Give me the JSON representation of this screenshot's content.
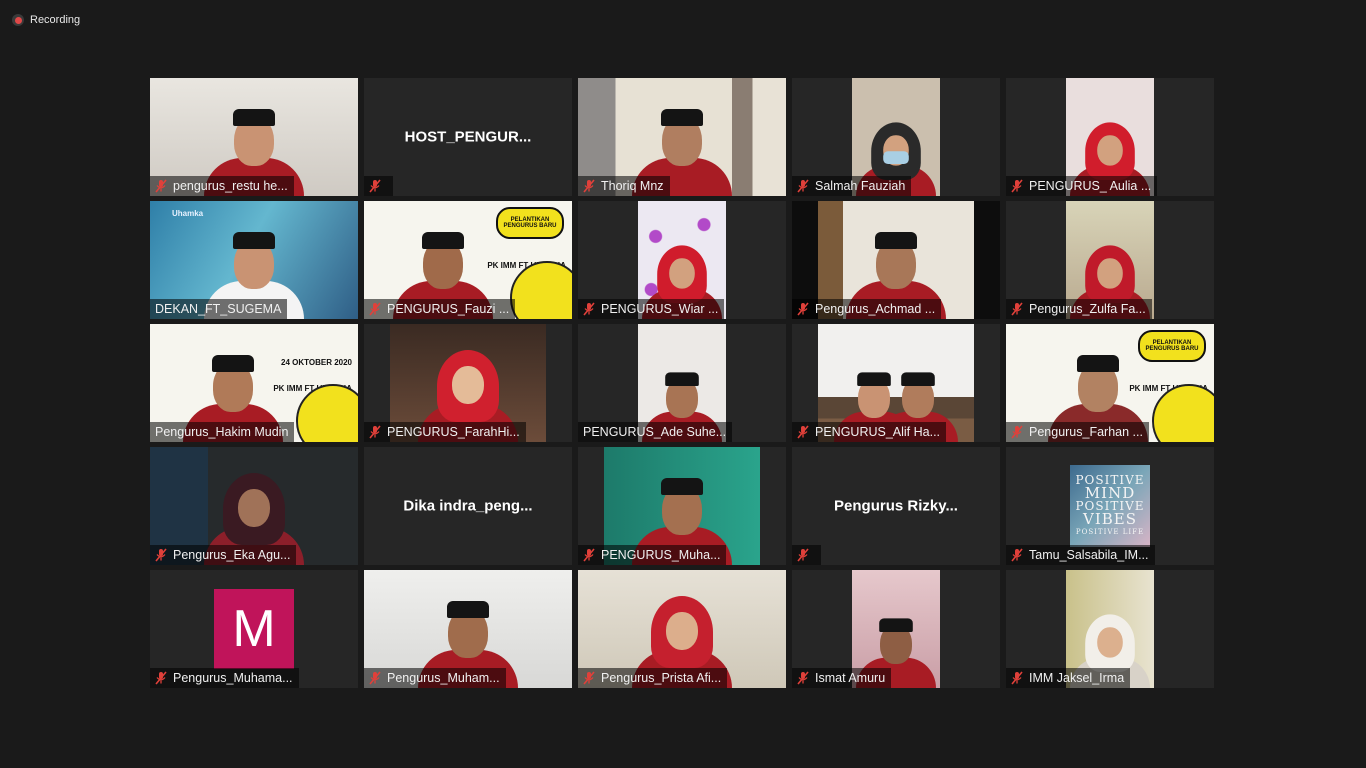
{
  "recording": {
    "label": "Recording"
  },
  "participants": [
    {
      "name": "pengurus_restu he...",
      "muted": true
    },
    {
      "name": "HOST_PENGUR...",
      "muted": true,
      "name_only": true
    },
    {
      "name": "Thoriq Mnz",
      "muted": true
    },
    {
      "name": "Salmah Fauziah",
      "muted": true
    },
    {
      "name": "PENGURUS_ Aulia ...",
      "muted": true
    },
    {
      "name": "DEKAN_FT_SUGEMA",
      "muted": false
    },
    {
      "name": "PENGURUS_Fauzi ...",
      "muted": true
    },
    {
      "name": "PENGURUS_Wiar ...",
      "muted": true
    },
    {
      "name": "Pengurus_Achmad ...",
      "muted": true
    },
    {
      "name": "Pengurus_Zulfa Fa...",
      "muted": true
    },
    {
      "name": "Pengurus_Hakim Mudin",
      "muted": false,
      "active_speaker": true
    },
    {
      "name": "PENGURUS_FarahHi...",
      "muted": true
    },
    {
      "name": "PENGURUS_Ade Suhe...",
      "muted": false
    },
    {
      "name": "PENGURUS_Alif Ha...",
      "muted": true
    },
    {
      "name": "Pengurus_Farhan ...",
      "muted": true
    },
    {
      "name": "Pengurus_Eka Agu...",
      "muted": true
    },
    {
      "name": "Dika  indra_peng...",
      "muted": false,
      "name_only": true
    },
    {
      "name": "PENGURUS_Muha...",
      "muted": true
    },
    {
      "name": "Pengurus  Rizky...",
      "muted": true,
      "name_only": true
    },
    {
      "name": "Tamu_Salsabila_IM...",
      "muted": true
    },
    {
      "name": "Pengurus_Muhama...",
      "muted": true,
      "avatar_letter": "M"
    },
    {
      "name": "Pengurus_Muham...",
      "muted": true
    },
    {
      "name": "Pengurus_Prista Afi...",
      "muted": true
    },
    {
      "name": "Ismat Amuru",
      "muted": true
    },
    {
      "name": "IMM Jaksel_Irma",
      "muted": true
    }
  ],
  "banners": {
    "pelantikan": "PELANTIKAN PENGURUS BARU",
    "pk_line": "PK IMM FT UHAMKA",
    "date": "24 OKTOBER 2020",
    "uhamka": "Uhamka"
  },
  "poster_text": [
    "POSITIVE",
    "MIND",
    "POSITIVE",
    "VIBES",
    "POSITIVE LIFE"
  ],
  "colors": {
    "accent_speaker": "#e8f05a",
    "muted_icon": "#e0403a",
    "background": "#1a1a1a"
  }
}
